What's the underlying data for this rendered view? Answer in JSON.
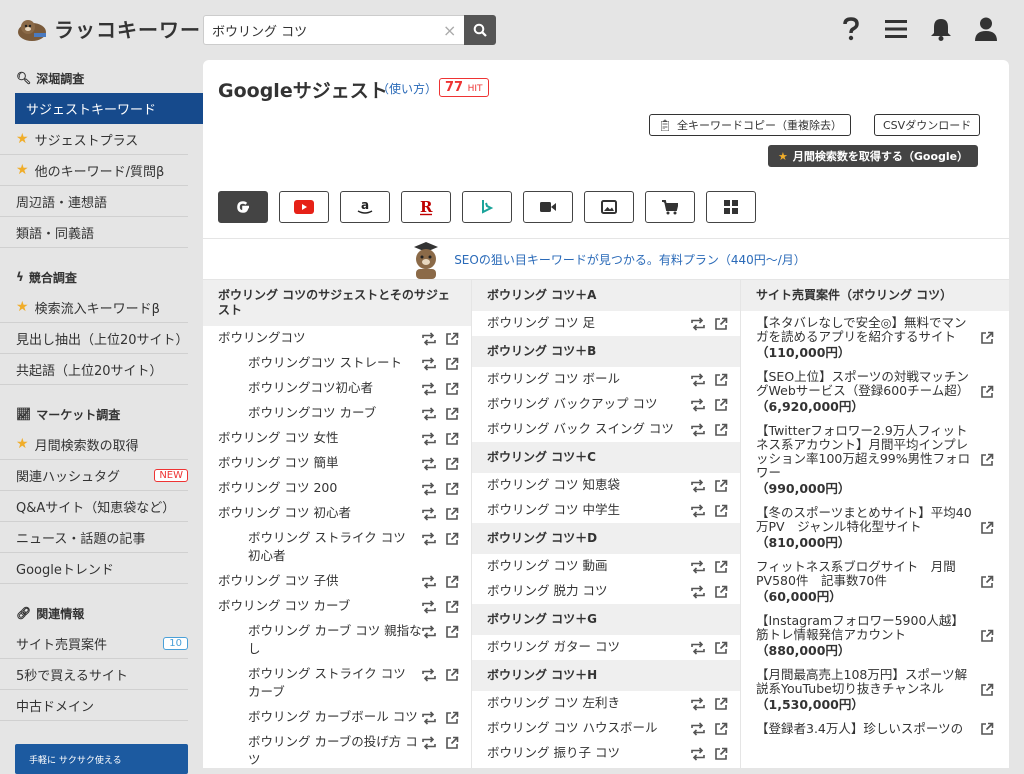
{
  "app": {
    "logo_text": "ラッコキーワード"
  },
  "search": {
    "value": "ボウリング コツ",
    "clear": "×"
  },
  "sidebar": {
    "sections": [
      {
        "title": "深堀調査",
        "items": [
          {
            "label": "サジェストキーワード",
            "active": true
          },
          {
            "label": "サジェストプラス",
            "star": true
          },
          {
            "label": "他のキーワード/質問β",
            "star": true
          },
          {
            "label": "周辺語・連想語"
          },
          {
            "label": "類語・同義語"
          }
        ]
      },
      {
        "title": "競合調査",
        "items": [
          {
            "label": "検索流入キーワードβ",
            "star": true
          },
          {
            "label": "見出し抽出（上位20サイト）"
          },
          {
            "label": "共起語（上位20サイト）"
          }
        ]
      },
      {
        "title": "マーケット調査",
        "items": [
          {
            "label": "月間検索数の取得",
            "star": true
          },
          {
            "label": "関連ハッシュタグ",
            "badge": "NEW"
          },
          {
            "label": "Q&Aサイト（知恵袋など）"
          },
          {
            "label": "ニュース・話題の記事"
          },
          {
            "label": "Googleトレンド"
          }
        ]
      },
      {
        "title": "関連情報",
        "items": [
          {
            "label": "サイト売買案件",
            "count": "10"
          },
          {
            "label": "5秒で買えるサイト"
          },
          {
            "label": "中古ドメイン"
          }
        ]
      }
    ],
    "banner": "手軽に サクサク使える"
  },
  "main": {
    "title": "Googleサジェスト",
    "howto": "（使い方）",
    "hit_count": "77",
    "hit_label": "HIT",
    "copy_all": "全キーワードコピー（重複除去）",
    "csv": "CSVダウンロード",
    "monthly": "月間検索数を取得する（Google）",
    "promo": "SEOの狙い目キーワードが見つかる。有料プラン（440円〜/月）"
  },
  "col1": {
    "header": "ボウリング コツのサジェストとそのサジェスト",
    "rows": [
      {
        "text": "ボウリングコツ",
        "sub": false
      },
      {
        "text": "ボウリングコツ ストレート",
        "sub": true
      },
      {
        "text": "ボウリングコツ初心者",
        "sub": true
      },
      {
        "text": "ボウリングコツ カーブ",
        "sub": true
      },
      {
        "text": "ボウリング コツ 女性",
        "sub": false
      },
      {
        "text": "ボウリング コツ 簡単",
        "sub": false
      },
      {
        "text": "ボウリング コツ 200",
        "sub": false
      },
      {
        "text": "ボウリング コツ 初心者",
        "sub": false
      },
      {
        "text": "ボウリング ストライク コツ 初心者",
        "sub": true,
        "wrap": true
      },
      {
        "text": "ボウリング コツ 子供",
        "sub": false
      },
      {
        "text": "ボウリング コツ カーブ",
        "sub": false
      },
      {
        "text": "ボウリング カーブ コツ 親指なし",
        "sub": true,
        "wrap": true
      },
      {
        "text": "ボウリング ストライク コツ カーブ",
        "sub": true,
        "wrap": true
      },
      {
        "text": "ボウリング カーブボール コツ",
        "sub": true,
        "wrap": true
      },
      {
        "text": "ボウリング カーブの投げ方 コツ",
        "sub": true,
        "wrap": true
      }
    ]
  },
  "col2": {
    "groups": [
      {
        "header": "ボウリング コツ＋A",
        "rows": [
          "ボウリング コツ 足"
        ]
      },
      {
        "header": "ボウリング コツ＋B",
        "rows": [
          "ボウリング コツ ボール",
          "ボウリング バックアップ コツ",
          "ボウリング バック スイング コツ"
        ]
      },
      {
        "header": "ボウリング コツ＋C",
        "rows": [
          "ボウリング コツ 知恵袋",
          "ボウリング コツ 中学生"
        ]
      },
      {
        "header": "ボウリング コツ＋D",
        "rows": [
          "ボウリング コツ 動画",
          "ボウリング 脱力 コツ"
        ]
      },
      {
        "header": "ボウリング コツ＋G",
        "rows": [
          "ボウリング ガター コツ"
        ]
      },
      {
        "header": "ボウリング コツ＋H",
        "rows": [
          "ボウリング コツ 左利き",
          "ボウリング コツ ハウスボール",
          "ボウリング 振り子 コツ"
        ]
      }
    ]
  },
  "col3": {
    "header": "サイト売買案件（ボウリング コツ）",
    "items": [
      {
        "title": "【ネタバレなしで安全◎】無料でマンガを読めるアプリを紹介するサイト",
        "price": "（110,000円）"
      },
      {
        "title": "【SEO上位】スポーツの対戦マッチングWebサービス（登録600チーム超）",
        "price": "（6,920,000円）"
      },
      {
        "title": "【Twitterフォロワー2.9万人フィットネス系アカウント】月間平均インプレッション率100万超え99%男性フォロワー",
        "price": "（990,000円）"
      },
      {
        "title": "【冬のスポーツまとめサイト】平均40万PV　ジャンル特化型サイト",
        "price": "（810,000円）"
      },
      {
        "title": "フィットネス系ブログサイト　月間PV580件　記事数70件",
        "price": "（60,000円）"
      },
      {
        "title": "【Instagramフォロワー5900人越】筋トレ情報発信アカウント",
        "price": "（880,000円）"
      },
      {
        "title": "【月間最高売上108万円】スポーツ解説系YouTube切り抜きチャンネル",
        "price": "（1,530,000円）"
      },
      {
        "title": "【登録者3.4万人】珍しいスポーツの",
        "price": ""
      }
    ]
  }
}
